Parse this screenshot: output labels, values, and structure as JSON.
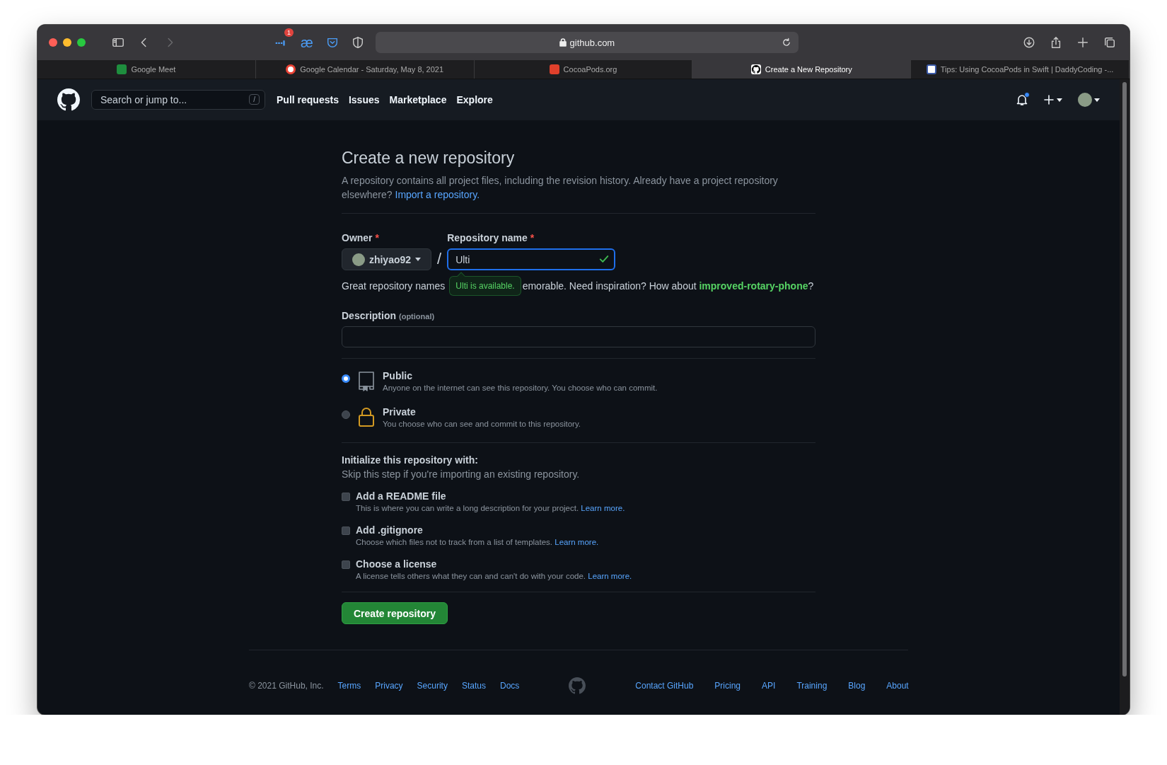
{
  "browser": {
    "address": "github.com",
    "extension_badge": "1",
    "extension_glyph": "æ",
    "forward_disabled": true
  },
  "tabs": [
    {
      "label": "Google Meet",
      "selected": false
    },
    {
      "label": "Google Calendar - Saturday, May 8, 2021",
      "selected": false
    },
    {
      "label": "CocoaPods.org",
      "selected": false
    },
    {
      "label": "Create a New Repository",
      "selected": true
    },
    {
      "label": "Tips: Using CocoaPods in Swift | DaddyCoding -...",
      "selected": false
    }
  ],
  "header": {
    "search_placeholder": "Search or jump to...",
    "search_key": "/",
    "nav": [
      "Pull requests",
      "Issues",
      "Marketplace",
      "Explore"
    ],
    "notification_unread": true
  },
  "form": {
    "title": "Create a new repository",
    "intro": "A repository contains all project files, including the revision history. Already have a project repository elsewhere?",
    "import_link": "Import a repository.",
    "owner_label": "Owner",
    "required_mark": "*",
    "owner": "zhiyao92",
    "separator": "/",
    "name_label": "Repository name",
    "name_value": "Ulti",
    "name_valid": true,
    "hint_start": "Great repository names",
    "hint_rest": "emorable. Need inspiration? How about **improved-rotary-phone**?",
    "tooltip": "Ulti is available.",
    "description_label": "Description",
    "description_optional": "(optional)",
    "visibility": [
      {
        "kind": "public",
        "label": "Public",
        "text": "Anyone on the internet can see this repository. You choose who can commit.",
        "selected": true
      },
      {
        "kind": "private",
        "label": "Private",
        "text": "You choose who can see and commit to this repository.",
        "selected": false
      }
    ],
    "init_title": "Initialize this repository with:",
    "init_text": "Skip this step if you're importing an existing repository.",
    "options": [
      {
        "label": "Add a README file",
        "text": "This is where you can write a long description for your project.",
        "link": "Learn more.",
        "checked": false
      },
      {
        "label": "Add .gitignore",
        "text": "Choose which files not to track from a list of templates.",
        "link": "Learn more.",
        "checked": false
      },
      {
        "label": "Choose a license",
        "text": "A license tells others what they can and can't do with your code.",
        "link": "Learn more.",
        "checked": false
      }
    ],
    "submit": "Create repository"
  },
  "footer": {
    "copyright": "© 2021 GitHub, Inc.",
    "left_links": [
      "Terms",
      "Privacy",
      "Security",
      "Status",
      "Docs"
    ],
    "right_links": [
      "Contact GitHub",
      "Pricing",
      "API",
      "Training",
      "Blog",
      "About"
    ]
  }
}
